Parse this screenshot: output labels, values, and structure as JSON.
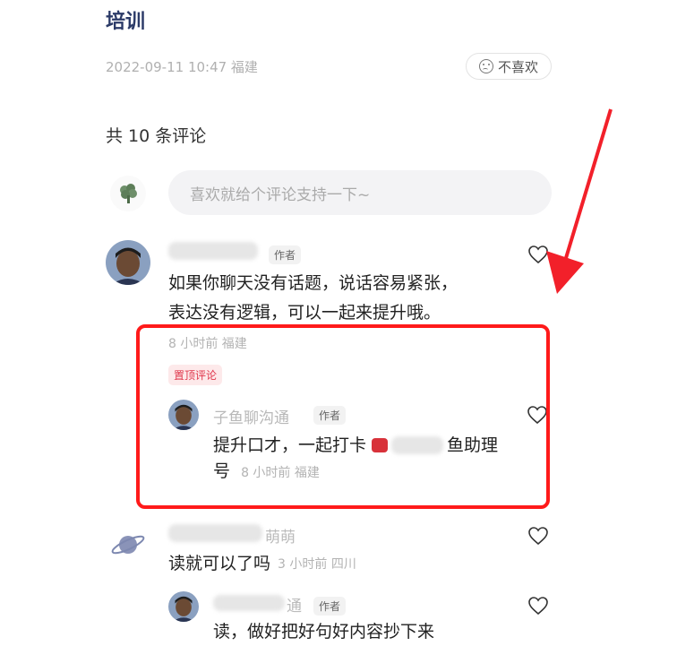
{
  "article": {
    "title": "培训",
    "meta": "2022-09-11 10:47 福建",
    "dislike_label": "不喜欢"
  },
  "comments_header": {
    "count_text": "共 10 条评论"
  },
  "comment_input": {
    "placeholder": "喜欢就给个评论支持一下~"
  },
  "comments": [
    {
      "author_tag": "作者",
      "text_line1": "如果你聊天没有话题，说话容易紧张，",
      "text_line2": "表达没有逻辑，可以一起来提升哦。",
      "time_location": "8 小时前 福建",
      "pinned_label": "置顶评论",
      "reply": {
        "author": "子鱼聊沟通",
        "author_tag": "作者",
        "text_line1a": "提升口才，一起打卡",
        "text_line1b": "鱼助理",
        "text_line2": "号",
        "time_location": "8 小时前 福建"
      }
    },
    {
      "author_partial": "萌萌",
      "text": "读就可以了吗",
      "time_location": "3 小时前 四川",
      "reply": {
        "author_partial": "通",
        "author_tag": "作者",
        "text": "读，做好把好句好内容抄下来"
      }
    }
  ],
  "colors": {
    "highlight": "#ff1a1a",
    "arrow": "#f2202a",
    "pin": "#e0364b",
    "title": "#2b3a67"
  }
}
